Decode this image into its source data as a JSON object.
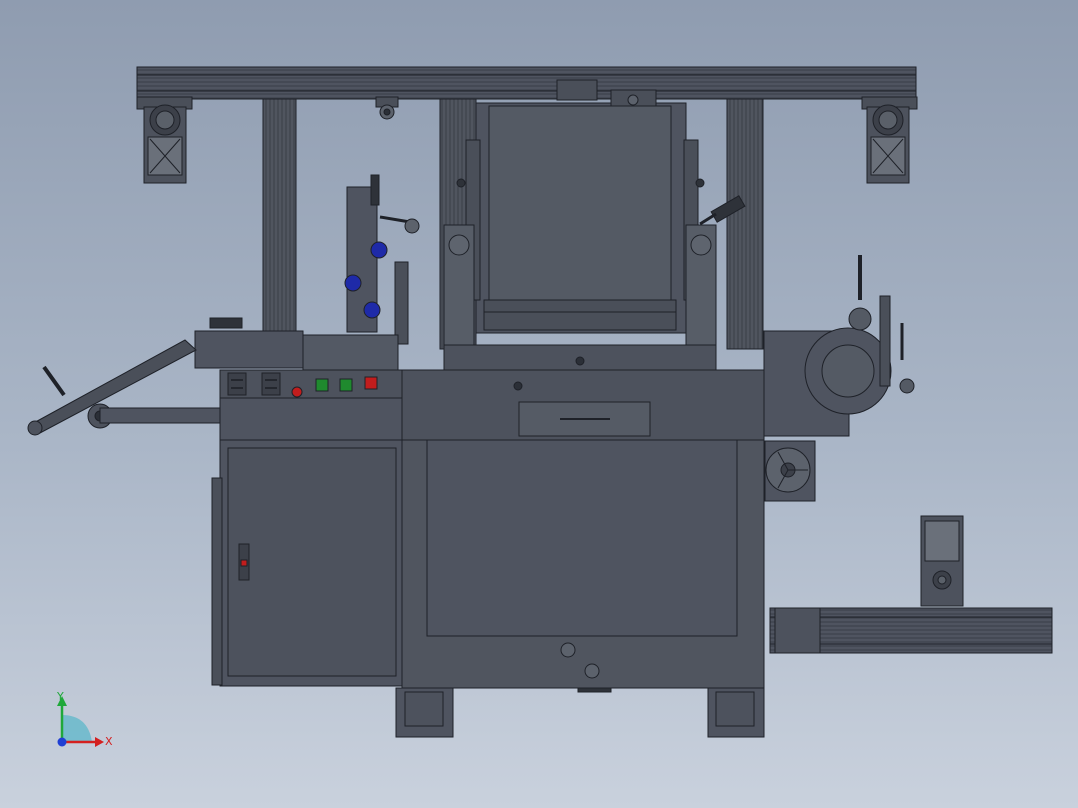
{
  "viewport": {
    "background_top": "#8f9cb0",
    "background_bottom": "#c9d1dd",
    "model_body_color": "#4d525d",
    "model_edge_color": "#1e2128",
    "accent_blue": "#1e2aa8",
    "accent_red": "#c21d1d",
    "accent_green": "#1f8a2e"
  },
  "triad": {
    "x_label": "X",
    "y_label": "Y",
    "x_color": "#d42020",
    "y_color": "#1fa83a",
    "z_color": "#1f3fd4"
  }
}
